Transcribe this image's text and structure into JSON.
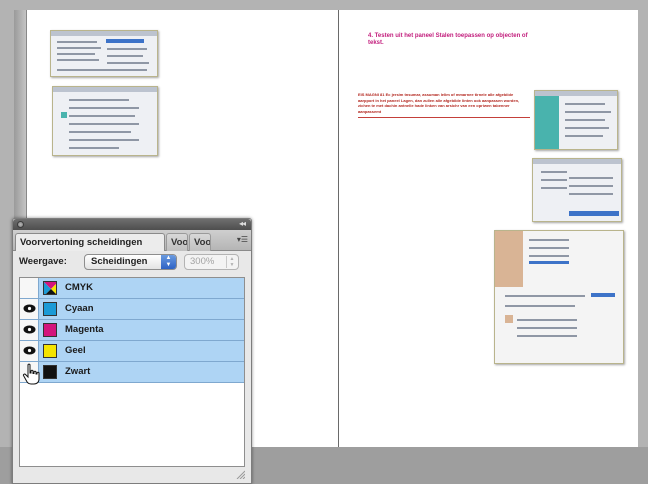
{
  "document": {
    "heading": "4. Testen uit het paneel Stalen toepassen op objecten of tekst.",
    "body": "EIS MAGNI 81 Ec jersim tnsumar, assuman lelim of mmarnee tirnele alle afgebiide aarpport in het paneel Lagen, dan zullen alle afgebilde linten ook aanpassen worden, zichen te met dachin antnelle hade linken van arsichr van een opriwen tabenner aanpassemt"
  },
  "panel": {
    "tabs": [
      "Voorvertoning scheidingen",
      "Voo",
      "Voo"
    ],
    "view_label": "Weergave:",
    "view_value": "Scheidingen",
    "zoom_value": "300%",
    "separations": [
      {
        "name": "CMYK",
        "color": "#ffffff",
        "visible": false
      },
      {
        "name": "Cyaan",
        "color": "#1b9ad6",
        "visible": true
      },
      {
        "name": "Magenta",
        "color": "#d3157d",
        "visible": true
      },
      {
        "name": "Geel",
        "color": "#f5e400",
        "visible": true
      },
      {
        "name": "Zwart",
        "color": "#111111",
        "visible": false
      }
    ]
  },
  "colors": {
    "selection": "#aed4f4",
    "heading": "#c21d7c",
    "body": "#b3261e"
  },
  "icons": [
    "close-icon",
    "collapse-icon",
    "panel-menu-icon",
    "eye-icon",
    "select-arrows-icon",
    "hand-cursor-icon",
    "resize-grip-icon"
  ]
}
